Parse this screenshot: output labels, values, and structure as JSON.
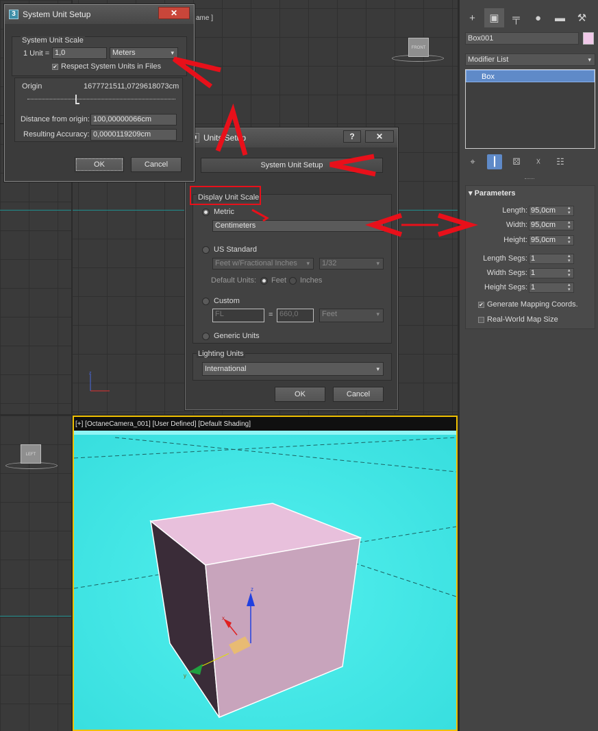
{
  "viewports": {
    "front_label": "ame ]",
    "front_cube": "FRONT",
    "left_cube": "LEFT",
    "persp_label": "[+] [OctaneCamera_001] [User Defined] [Default Shading]"
  },
  "command_panel": {
    "tabs": [
      {
        "icon": "create-icon",
        "glyph": "+"
      },
      {
        "icon": "modify-icon",
        "glyph": "▣"
      },
      {
        "icon": "hierarchy-icon",
        "glyph": "╤"
      },
      {
        "icon": "motion-icon",
        "glyph": "●"
      },
      {
        "icon": "display-icon",
        "glyph": "▬"
      },
      {
        "icon": "utilities-icon",
        "glyph": "⚒"
      }
    ],
    "object_name": "Box001",
    "object_color": "#f0c8e8",
    "modifier_list": "Modifier List",
    "stack_items": [
      "Box"
    ],
    "rollout": {
      "title": "Parameters",
      "length_label": "Length:",
      "length_value": "95,0cm",
      "width_label": "Width:",
      "width_value": "95,0cm",
      "height_label": "Height:",
      "height_value": "95,0cm",
      "length_segs_label": "Length Segs:",
      "length_segs_value": "1",
      "width_segs_label": "Width Segs:",
      "width_segs_value": "1",
      "height_segs_label": "Height Segs:",
      "height_segs_value": "1",
      "gen_mapping_label": "Generate Mapping Coords.",
      "gen_mapping_checked": true,
      "real_world_label": "Real-World Map Size",
      "real_world_checked": false
    }
  },
  "system_unit_setup": {
    "title": "System Unit Setup",
    "group_title": "System Unit Scale",
    "unit_label": "1 Unit =",
    "unit_value": "1,0",
    "unit_type": "Meters",
    "respect_label": "Respect System Units in Files",
    "origin_label": "Origin",
    "origin_value": "1677721511,0729618073cm",
    "distance_label": "Distance from origin:",
    "distance_value": "100,00000066cm",
    "accuracy_label": "Resulting Accuracy:",
    "accuracy_value": "0,0000119209cm",
    "ok": "OK",
    "cancel": "Cancel"
  },
  "units_setup": {
    "title": "Units Setup",
    "help": "?",
    "system_button": "System Unit Setup",
    "display_group": "Display Unit Scale",
    "metric_label": "Metric",
    "metric_value": "Centimeters",
    "us_label": "US Standard",
    "us_value": "Feet w/Fractional Inches",
    "us_fraction": "1/32",
    "default_units_label": "Default Units:",
    "feet_label": "Feet",
    "inches_label": "Inches",
    "custom_label": "Custom",
    "custom_name": "FL",
    "custom_equals": "=",
    "custom_value": "660,0",
    "custom_unit": "Feet",
    "generic_label": "Generic Units",
    "lighting_group": "Lighting Units",
    "lighting_value": "International",
    "ok": "OK",
    "cancel": "Cancel"
  },
  "colors": {
    "annotation_red": "#e8101a",
    "viewport_bg": "#3de3e3",
    "active_border": "#f0c000",
    "selection_blue": "#5f8ac8"
  }
}
